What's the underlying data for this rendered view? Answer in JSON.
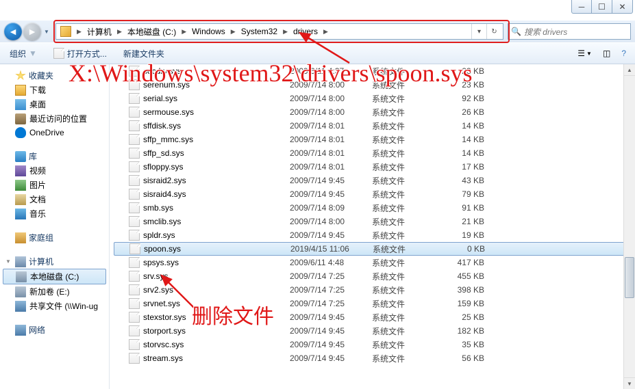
{
  "address": {
    "crumbs": [
      "计算机",
      "本地磁盘 (C:)",
      "Windows",
      "System32",
      "drivers"
    ],
    "refresh_icon": "refresh-icon",
    "dropdown_icon": "chevron-down-icon"
  },
  "search": {
    "placeholder": "搜索 drivers"
  },
  "toolbar": {
    "organize": "组织",
    "openwith": "打开方式...",
    "newfolder": "新建文件夹"
  },
  "sidebar": {
    "favorites": {
      "label": "收藏夹",
      "items": [
        "下载",
        "桌面",
        "最近访问的位置",
        "OneDrive"
      ]
    },
    "libraries": {
      "label": "库",
      "items": [
        "视频",
        "图片",
        "文档",
        "音乐"
      ]
    },
    "homegroup": {
      "label": "家庭组"
    },
    "computer": {
      "label": "计算机",
      "items": [
        "本地磁盘 (C:)",
        "新加卷 (E:)",
        "共享文件 (\\\\Win-ug"
      ]
    },
    "network": {
      "label": "网络"
    }
  },
  "columns": {
    "type_label": "系统文件"
  },
  "files": [
    {
      "name": "secdrv.sys",
      "date": "2009/6/11 4:37",
      "size": "23 KB"
    },
    {
      "name": "serenum.sys",
      "date": "2009/7/14 8:00",
      "size": "23 KB"
    },
    {
      "name": "serial.sys",
      "date": "2009/7/14 8:00",
      "size": "92 KB"
    },
    {
      "name": "sermouse.sys",
      "date": "2009/7/14 8:00",
      "size": "26 KB"
    },
    {
      "name": "sffdisk.sys",
      "date": "2009/7/14 8:01",
      "size": "14 KB"
    },
    {
      "name": "sffp_mmc.sys",
      "date": "2009/7/14 8:01",
      "size": "14 KB"
    },
    {
      "name": "sffp_sd.sys",
      "date": "2009/7/14 8:01",
      "size": "14 KB"
    },
    {
      "name": "sfloppy.sys",
      "date": "2009/7/14 8:01",
      "size": "17 KB"
    },
    {
      "name": "sisraid2.sys",
      "date": "2009/7/14 9:45",
      "size": "43 KB"
    },
    {
      "name": "sisraid4.sys",
      "date": "2009/7/14 9:45",
      "size": "79 KB"
    },
    {
      "name": "smb.sys",
      "date": "2009/7/14 8:09",
      "size": "91 KB"
    },
    {
      "name": "smclib.sys",
      "date": "2009/7/14 8:00",
      "size": "21 KB"
    },
    {
      "name": "spldr.sys",
      "date": "2009/7/14 9:45",
      "size": "19 KB"
    },
    {
      "name": "spoon.sys",
      "date": "2019/4/15 11:06",
      "size": "0 KB",
      "selected": true
    },
    {
      "name": "spsys.sys",
      "date": "2009/6/11 4:48",
      "size": "417 KB"
    },
    {
      "name": "srv.sys",
      "date": "2009/7/14 7:25",
      "size": "455 KB"
    },
    {
      "name": "srv2.sys",
      "date": "2009/7/14 7:25",
      "size": "398 KB"
    },
    {
      "name": "srvnet.sys",
      "date": "2009/7/14 7:25",
      "size": "159 KB"
    },
    {
      "name": "stexstor.sys",
      "date": "2009/7/14 9:45",
      "size": "25 KB"
    },
    {
      "name": "storport.sys",
      "date": "2009/7/14 9:45",
      "size": "182 KB"
    },
    {
      "name": "storvsc.sys",
      "date": "2009/7/14 9:45",
      "size": "35 KB"
    },
    {
      "name": "stream.sys",
      "date": "2009/7/14 9:45",
      "size": "56 KB"
    }
  ],
  "annotations": {
    "path_text": "X:\\Windows\\system32\\drivers\\spoon.sys",
    "delete_text": "删除文件"
  }
}
